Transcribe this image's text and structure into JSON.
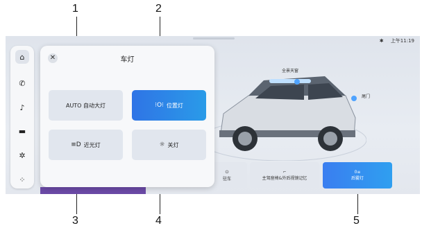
{
  "callouts": [
    "1",
    "2",
    "3",
    "4",
    "5"
  ],
  "status": {
    "bluetooth_icon": "bluetooth-icon",
    "time": "上午11:19"
  },
  "sidebar": {
    "icons": [
      "home-icon",
      "phone-icon",
      "music-icon",
      "vehicle-icon",
      "settings-icon",
      "apps-icon"
    ]
  },
  "panel": {
    "title": "车灯",
    "buttons": [
      {
        "label": "AUTO 自动大灯",
        "icon": ""
      },
      {
        "label": "位置灯",
        "icon": "position-light-icon"
      },
      {
        "label": "近光灯",
        "icon": "low-beam-icon"
      },
      {
        "label": "关灯",
        "icon": "lights-off-icon"
      }
    ],
    "active_button": "位置灯"
  },
  "vehicle": {
    "tag_sunroof": "全景天窗",
    "tag_tailgate": "尾门"
  },
  "tiles": [
    {
      "label": "驻车"
    },
    {
      "label": "主驾座椅&外后视镜记忆"
    },
    {
      "label": "后雾灯"
    }
  ],
  "colors": {
    "accent": "#2f74e6",
    "panel_bg": "#f7f8fa",
    "button_bg": "#e1e6ee"
  }
}
